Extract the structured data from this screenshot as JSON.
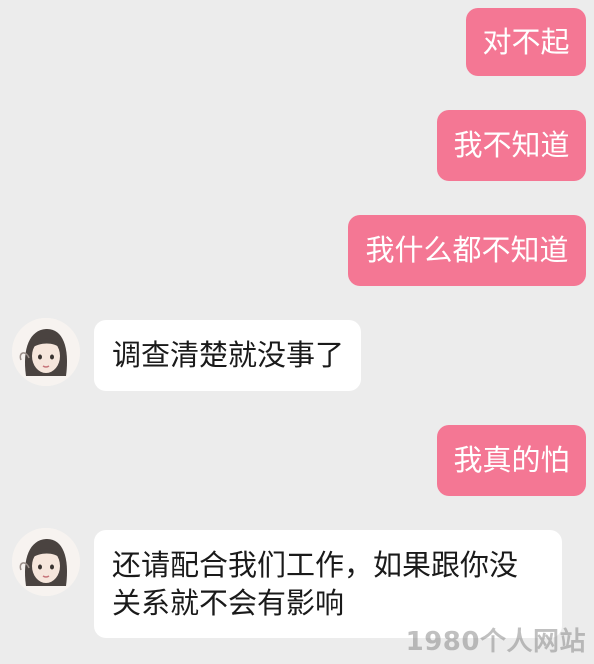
{
  "messages": [
    {
      "side": "sent",
      "text": "对不起"
    },
    {
      "side": "sent",
      "text": "我不知道"
    },
    {
      "side": "sent",
      "text": "我什么都不知道"
    },
    {
      "side": "received",
      "text": "调查清楚就没事了"
    },
    {
      "side": "sent",
      "text": "我真的怕"
    },
    {
      "side": "received",
      "text": "还请配合我们工作，如果跟你没关系就不会有影响"
    }
  ],
  "watermark": "1980个人网站",
  "colors": {
    "background": "#ececec",
    "sent_bubble": "#f47794",
    "received_bubble": "#ffffff"
  },
  "icons": {
    "avatar": "girl-avatar-icon"
  }
}
